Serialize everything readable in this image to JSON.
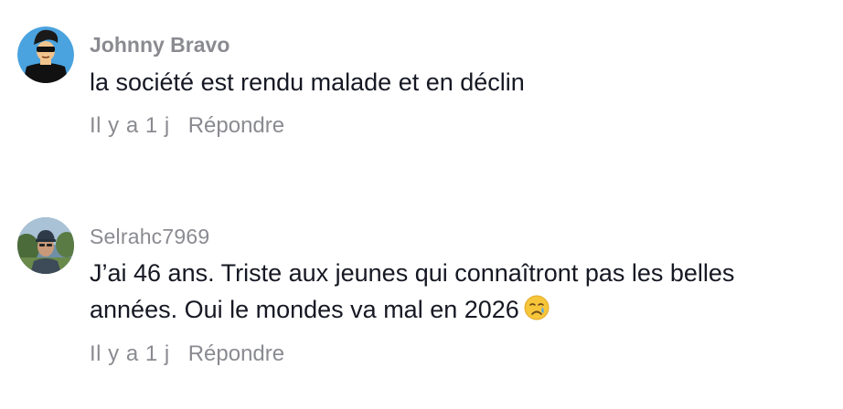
{
  "comments": [
    {
      "author": "Johnny Bravo",
      "text": "la société est rendu malade et en déclin",
      "time": "Il y a 1 j",
      "reply_label": "Répondre"
    },
    {
      "author": "Selrahc7969",
      "text_line1": "J’ai 46 ans. Triste aux jeunes qui connaîtront pas les belles",
      "text_line2": "années. Oui le mondes va mal en 2026",
      "emoji": "crying-face",
      "time": "Il y a 1 j",
      "reply_label": "Répondre"
    }
  ],
  "colors": {
    "text": "#161823",
    "secondary": "#8a8b91",
    "background": "#ffffff",
    "avatar1_bg": "#4aa3df"
  }
}
